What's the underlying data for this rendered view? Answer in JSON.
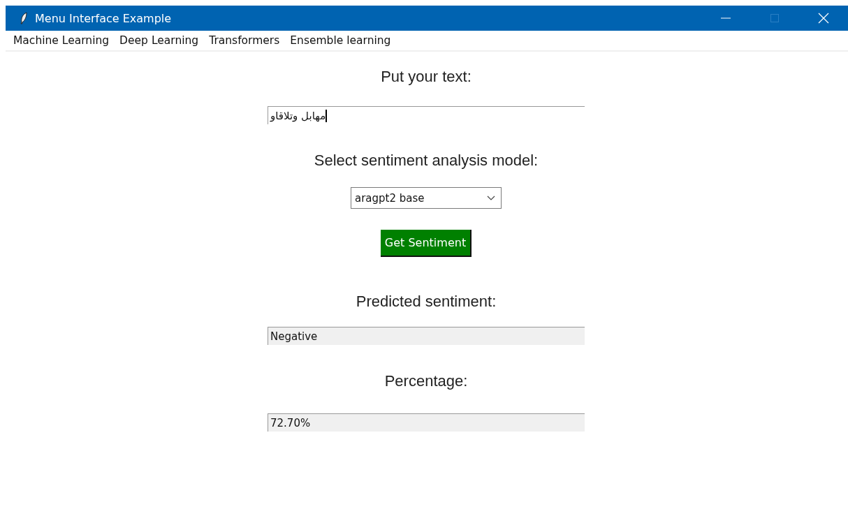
{
  "window": {
    "title": "Menu Interface Example",
    "maximize_disabled": true
  },
  "menu": [
    "Machine Learning",
    "Deep Learning",
    "Transformers",
    "Ensemble learning"
  ],
  "form": [
    {
      "kind": "label",
      "text": "Put your text:"
    },
    {
      "kind": "entry",
      "value": "مهابل وتلاقاو",
      "focused": true,
      "readonly": false
    },
    {
      "kind": "label",
      "text": "Select sentiment analysis model:"
    },
    {
      "kind": "combo",
      "value": "aragpt2 base"
    },
    {
      "kind": "button",
      "text": "Get Sentiment"
    },
    {
      "kind": "label",
      "text": "Predicted sentiment:"
    },
    {
      "kind": "entry",
      "value": "Negative",
      "focused": false,
      "readonly": true
    },
    {
      "kind": "label",
      "text": "Percentage:"
    },
    {
      "kind": "entry",
      "value": "72.70%",
      "focused": false,
      "readonly": true
    }
  ]
}
